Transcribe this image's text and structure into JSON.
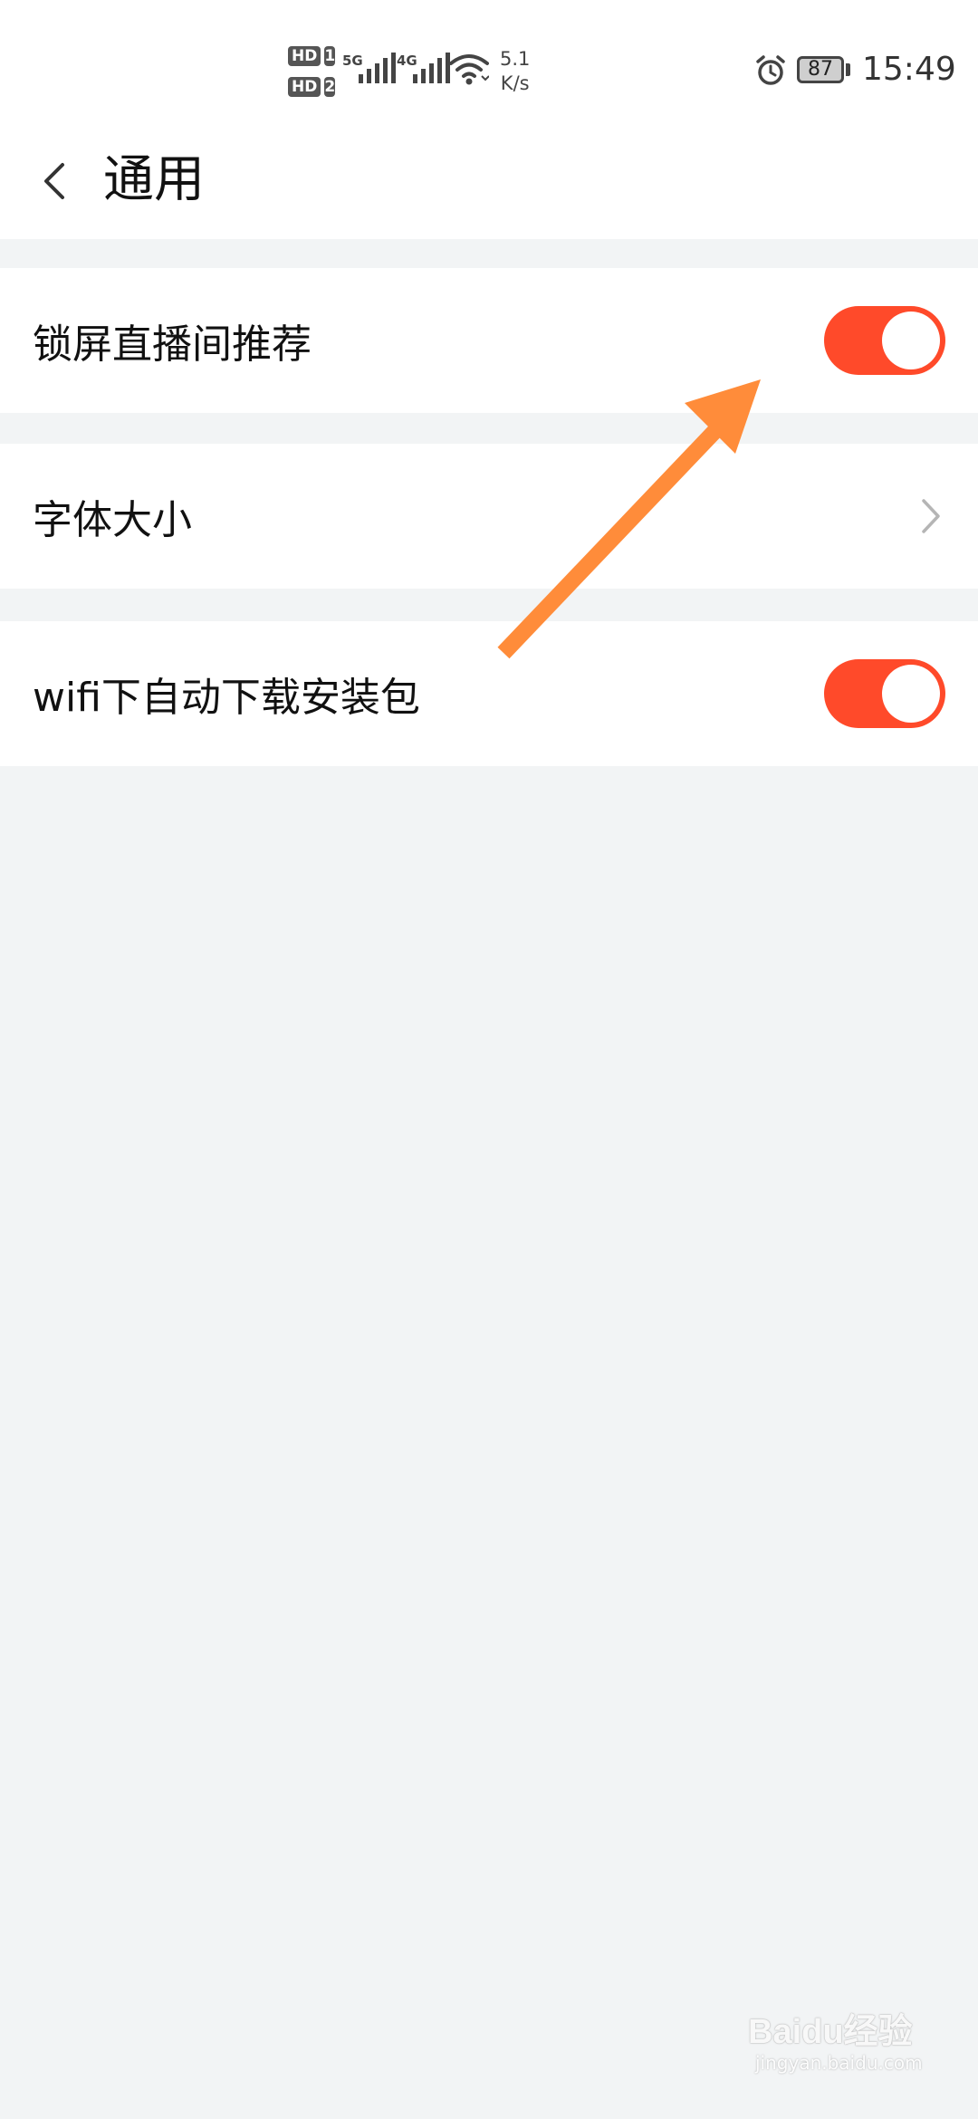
{
  "status_bar": {
    "hd1": "HD",
    "sim1": "1",
    "hd2": "HD",
    "sim2": "2",
    "net1": "5G",
    "net2": "4G",
    "speed_value": "5.1",
    "speed_unit": "K/s",
    "battery": "87",
    "time": "15:49"
  },
  "header": {
    "title": "通用",
    "back_icon": "chevron-left-icon"
  },
  "settings": [
    {
      "label": "锁屏直播间推荐",
      "control": "toggle",
      "on": true
    },
    {
      "label": "字体大小",
      "control": "chevron"
    },
    {
      "label": "wifi下自动下载安装包",
      "control": "toggle",
      "on": true
    }
  ],
  "colors": {
    "accent": "#ff4a2a",
    "background": "#f2f4f5",
    "card": "#ffffff",
    "annotation_arrow": "#ff8c3a"
  },
  "watermark": {
    "main": "Baidu经验",
    "sub": "jingyan.baidu.com"
  }
}
